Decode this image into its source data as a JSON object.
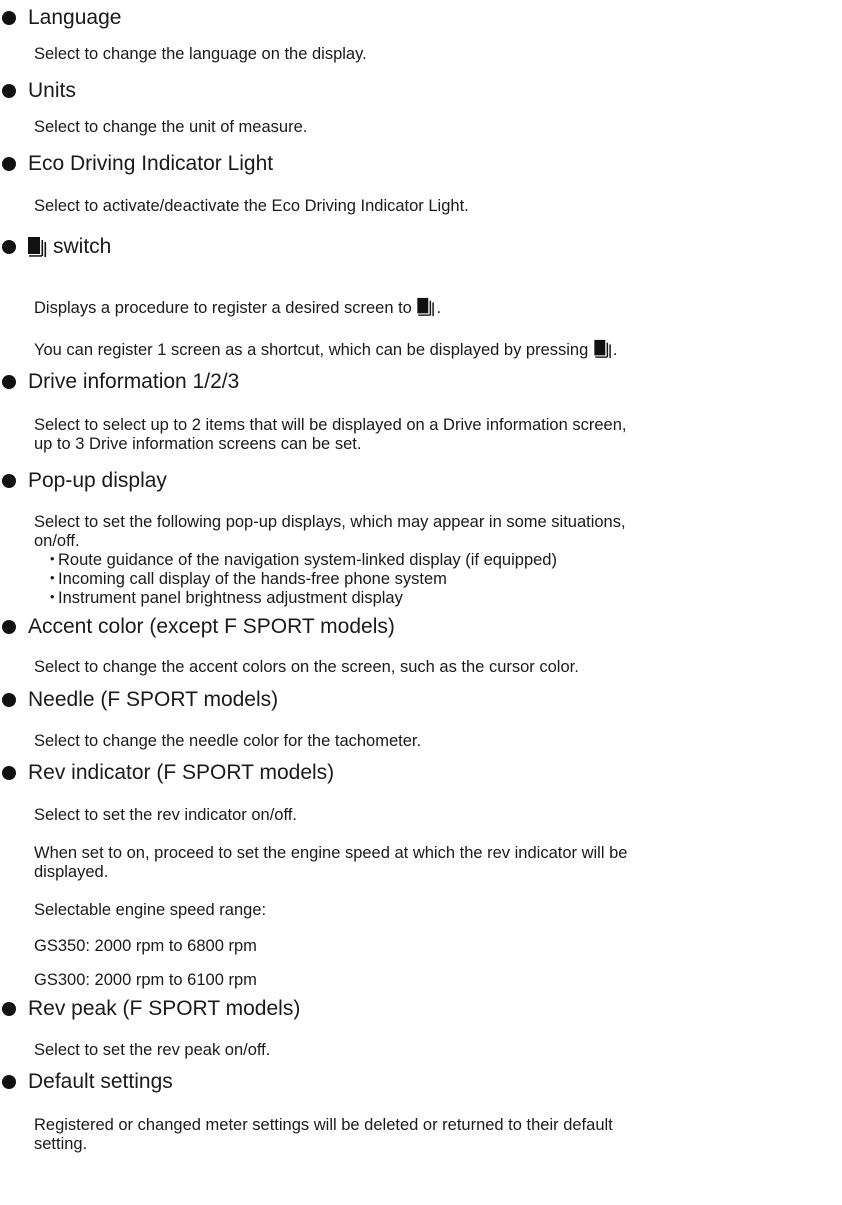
{
  "icon": "meter-display-switch-icon",
  "items": [
    {
      "title": "Language",
      "lines": [
        "Select to change the language on the display."
      ]
    },
    {
      "title": "Units",
      "lines": [
        "Select to change the unit of measure."
      ]
    },
    {
      "title": "Eco Driving Indicator Light",
      "lines": [
        "Select to activate/deactivate the Eco Driving Indicator Light."
      ]
    },
    {
      "title": "switch",
      "lines": [
        "Displays a procedure to register a desired screen to",
        "You can register 1 screen as a shortcut, which can be displayed by pressing"
      ]
    },
    {
      "title": "Drive information 1/2/3",
      "lines": [
        "Select to select up to 2 items that will be displayed on a Drive information screen,",
        "up to 3 Drive information screens can be set."
      ]
    },
    {
      "title": "Pop-up display",
      "lines": [
        "Select to set the following pop-up displays, which may appear in some situations,",
        "on/off."
      ],
      "sub": [
        "Route guidance of the navigation system-linked display (if equipped)",
        "Incoming call display of the hands-free phone system",
        "Instrument panel brightness adjustment display"
      ]
    },
    {
      "title": "Accent color (except F SPORT models)",
      "lines": [
        "Select to change the accent colors on the screen, such as the cursor color."
      ]
    },
    {
      "title": "Needle (F SPORT models)",
      "lines": [
        "Select to change the needle color for the tachometer."
      ]
    },
    {
      "title": "Rev indicator (F SPORT models)",
      "lines": [
        "Select to set the rev indicator on/off.",
        "When set to on, proceed to set the engine speed at which the rev indicator will be",
        "displayed.",
        "Selectable engine speed range:",
        "GS350: 2000 rpm to 6800 rpm",
        "GS300: 2000 rpm to 6100 rpm"
      ]
    },
    {
      "title": "Rev peak (F SPORT models)",
      "lines": [
        "Select to set the rev peak on/off."
      ]
    },
    {
      "title": "Default settings",
      "lines": [
        "Registered or changed meter settings will be deleted or returned to their default",
        "setting."
      ]
    }
  ]
}
